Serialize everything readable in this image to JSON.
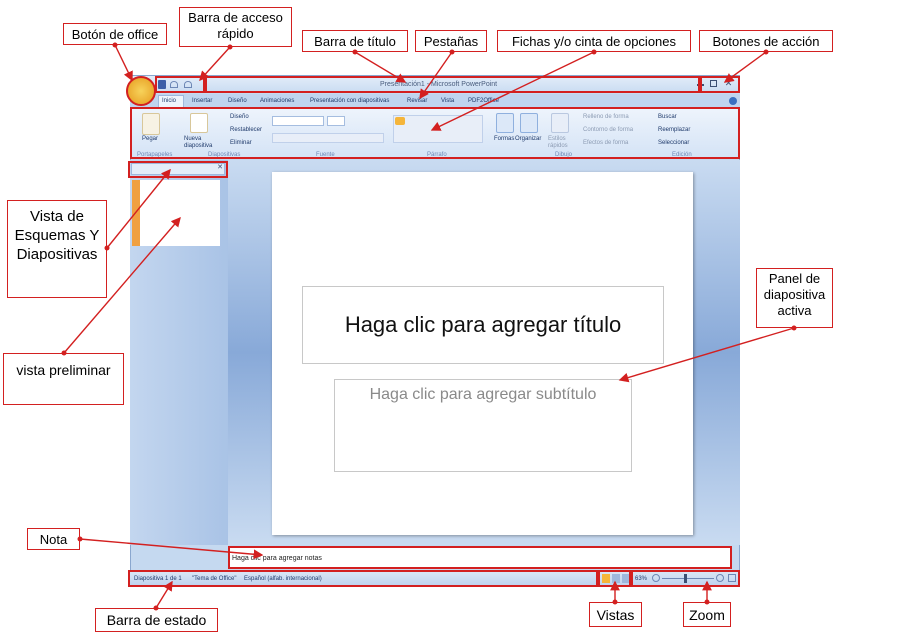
{
  "callouts": {
    "office_button": "Botón de office",
    "quick_access": "Barra de acceso rápido",
    "title_bar": "Barra de título",
    "tabs": "Pestañas",
    "ribbon": "Fichas y/o cinta de opciones",
    "action_buttons": "Botones de acción",
    "outline_view": "Vista de Esquemas Y Diapositivas",
    "preview": "vista preliminar",
    "slide_panel": "Panel de diapositiva activa",
    "notes": "Nota",
    "status_bar": "Barra de estado",
    "views": "Vistas",
    "zoom": "Zoom"
  },
  "window": {
    "title": "Presentación1 - Microsoft PowerPoint",
    "tabs": [
      "Inicio",
      "Insertar",
      "Diseño",
      "Animaciones",
      "Presentación con diapositivas",
      "Revisar",
      "Vista",
      "PDF2Office"
    ],
    "ribbon_groups": [
      "Portapapeles",
      "Diapositivas",
      "Fuente",
      "Párrafo",
      "Dibujo",
      "Edición"
    ],
    "ribbon_items": {
      "paste": "Pegar",
      "new_slide": "Nueva diapositiva",
      "layout": "Diseño",
      "reset": "Restablecer",
      "delete": "Eliminar",
      "shapes": "Formas",
      "arrange": "Organizar",
      "quick_styles": "Estilos rápidos",
      "shape_fill": "Relleno de forma",
      "shape_outline": "Contorno de forma",
      "shape_effects": "Efectos de forma",
      "find": "Buscar",
      "replace": "Reemplazar",
      "select": "Seleccionar"
    }
  },
  "slide": {
    "title_placeholder": "Haga clic para agregar título",
    "subtitle_placeholder": "Haga clic para agregar subtítulo"
  },
  "notes_placeholder": "Haga clic para agregar notas",
  "status": {
    "slide_count": "Diapositiva 1 de 1",
    "theme": "\"Tema de Office\"",
    "language": "Español (alfab. internacional)",
    "zoom_level": "63%"
  },
  "colors": {
    "callout_border": "#d32020",
    "window_bg": "#c5d9f0",
    "accent_orange": "#f0a040"
  }
}
